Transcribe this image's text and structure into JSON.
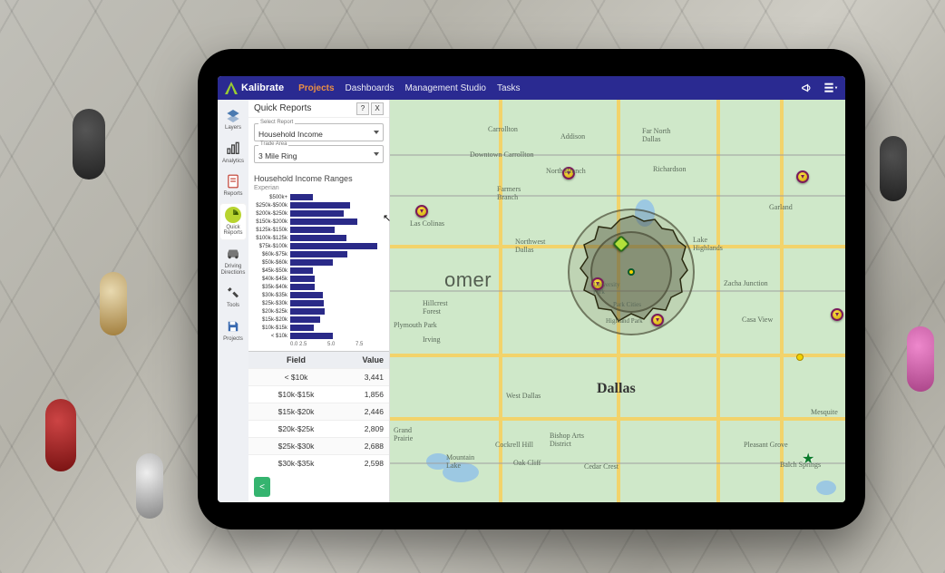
{
  "brand": "Kalibrate",
  "nav": {
    "projects": "Projects",
    "dashboards": "Dashboards",
    "mgmt": "Management Studio",
    "tasks": "Tasks"
  },
  "rail": [
    {
      "label": "Layers"
    },
    {
      "label": "Analytics"
    },
    {
      "label": "Reports"
    },
    {
      "label": "Quick\nReports"
    },
    {
      "label": "Driving\nDirections"
    },
    {
      "label": "Tools"
    },
    {
      "label": "Projects"
    }
  ],
  "panel": {
    "title": "Quick Reports",
    "help": "?",
    "close": "X",
    "select_report_label": "Select Report",
    "select_report_value": "Household Income",
    "trade_area_label": "Trade Area",
    "trade_area_value": "3 Mile Ring",
    "section_title": "Household Income Ranges",
    "source": "Experian",
    "collapse": "<"
  },
  "chart_data": {
    "type": "bar",
    "orientation": "horizontal",
    "title": "Household Income Ranges",
    "source": "Experian",
    "xlabel": "",
    "ylabel": "",
    "xlim": [
      0,
      7.5
    ],
    "xticks": [
      0,
      2.5,
      5.0,
      7.5
    ],
    "categories": [
      "$500k+",
      "$250k-$500k",
      "$200k-$250k",
      "$150k-$200k",
      "$125k-$150k",
      "$100k-$125k",
      "$75k-$100k",
      "$60k-$75k",
      "$50k-$60k",
      "$45k-$50k",
      "$40k-$45k",
      "$35k-$40k",
      "$30k-$35k",
      "$25k-$30k",
      "$20k-$25k",
      "$15k-$20k",
      "$10k-$15k",
      "< $10k"
    ],
    "values": [
      1.8,
      4.8,
      4.3,
      5.4,
      3.6,
      4.5,
      7.0,
      4.6,
      3.4,
      1.8,
      2.0,
      2.0,
      2.6,
      2.7,
      2.8,
      2.4,
      1.9,
      3.4
    ]
  },
  "table": {
    "field_header": "Field",
    "value_header": "Value",
    "rows": [
      {
        "f": "< $10k",
        "v": "3,441"
      },
      {
        "f": "$10k-$15k",
        "v": "1,856"
      },
      {
        "f": "$15k-$20k",
        "v": "2,446"
      },
      {
        "f": "$20k-$25k",
        "v": "2,809"
      },
      {
        "f": "$25k-$30k",
        "v": "2,688"
      },
      {
        "f": "$30k-$35k",
        "v": "2,598"
      }
    ]
  },
  "map": {
    "watermark": "omer",
    "big_city": "Dallas",
    "labels": {
      "carrollton": "Carrollton",
      "addison": "Addison",
      "farnorth": "Far North\nDallas",
      "farmers": "Farmers\nBranch",
      "nbranch": "North Branch",
      "richardson": "Richardson",
      "garland": "Garland",
      "lascolinas": "Las Colinas",
      "nwdallas": "Northwest\nDallas",
      "lakehigh": "Lake\nHighlands",
      "univpark": "University\nPark",
      "parkcities": "Park Cities",
      "highland": "Highland Park",
      "zacha": "Zacha Junction",
      "casaview": "Casa View",
      "irving": "Irving",
      "hillcrest": "Hillcrest\nForest",
      "plymouth": "Plymouth Park",
      "grand": "Grand\nPrairie",
      "wdallas": "West Dallas",
      "cockrell": "Cockrell Hill",
      "bishoparts": "Bishop Arts\nDistrict",
      "oakcliff": "Oak Cliff",
      "cedarcrest": "Cedar Crest",
      "pleasant": "Pleasant Grove",
      "balch": "Balch Springs",
      "mesquite": "Mesquite",
      "downtown": "Downtown\nCarrollton",
      "mountain": "Mountain\nLake"
    }
  }
}
